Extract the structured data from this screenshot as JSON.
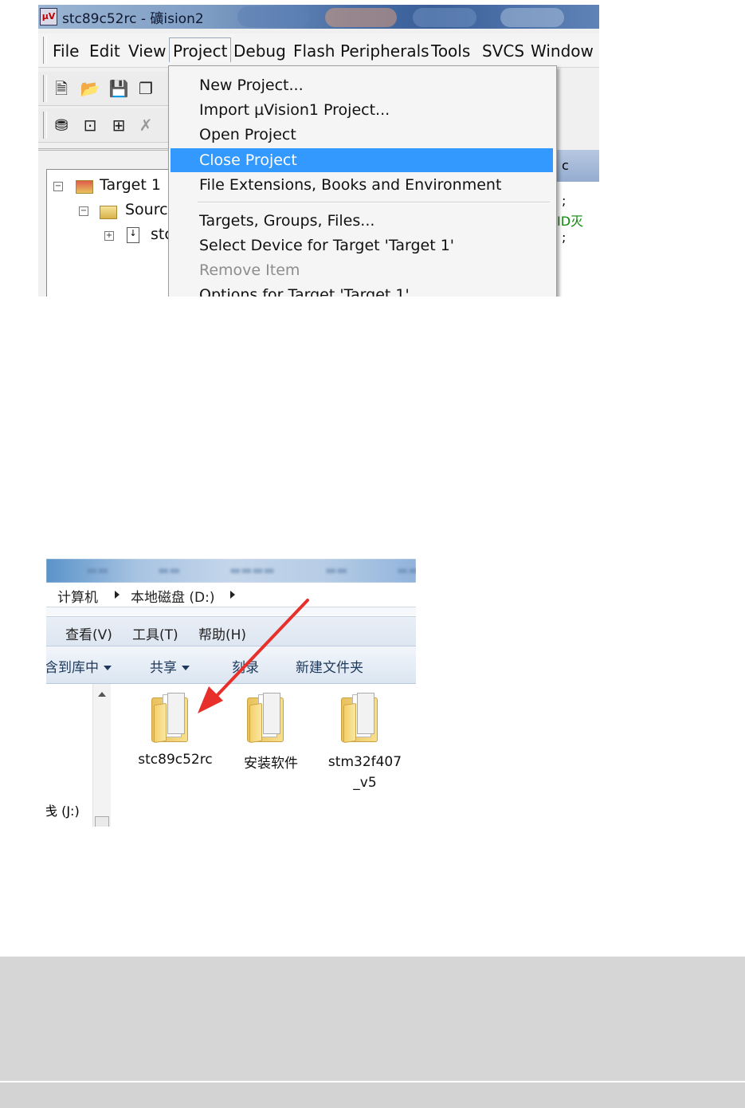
{
  "uvision": {
    "title": "stc89c52rc  - 礦ision2",
    "menu": [
      "File",
      "Edit",
      "View",
      "Project",
      "Debug",
      "Flash",
      "Peripherals",
      "Tools",
      "SVCS",
      "Window"
    ],
    "project_menu": [
      {
        "label": "New Project...",
        "state": "normal"
      },
      {
        "label": "Import µVision1 Project...",
        "state": "normal"
      },
      {
        "label": "Open Project",
        "state": "normal"
      },
      {
        "label": "Close Project",
        "state": "highlighted"
      },
      {
        "label": "File Extensions, Books and Environment",
        "state": "normal"
      },
      {
        "label": "Targets, Groups, Files...",
        "state": "normal"
      },
      {
        "label": "Select Device for Target 'Target 1'",
        "state": "normal"
      },
      {
        "label": "Remove Item",
        "state": "disabled"
      },
      {
        "label": "Options for Target 'Target 1'",
        "state": "normal"
      }
    ],
    "tree": {
      "target": "Target 1",
      "group": "Sourc",
      "file": "stc"
    },
    "code_fragments": [
      "c",
      ";",
      "ID灭",
      ";"
    ],
    "toolbar1_icons": [
      "new-file-icon",
      "open-folder-icon",
      "save-icon",
      "save-all-icon"
    ],
    "toolbar2_icons": [
      "build-target-icon",
      "load-icon",
      "download-icon",
      "stop-build-icon"
    ]
  },
  "explorer": {
    "breadcrumb": [
      "计算机",
      "本地磁盘 (D:)"
    ],
    "menu": [
      "查看(V)",
      "工具(T)",
      "帮助(H)"
    ],
    "commands": [
      "含到库中",
      "共享",
      "刻录",
      "新建文件夹"
    ],
    "nav_drive": "戋 (J:)",
    "folders": [
      {
        "name": "stc89c52rc"
      },
      {
        "name": "安装软件"
      },
      {
        "name": "stm32f407\n_v5"
      }
    ],
    "arrow_color": "#e8302a"
  }
}
